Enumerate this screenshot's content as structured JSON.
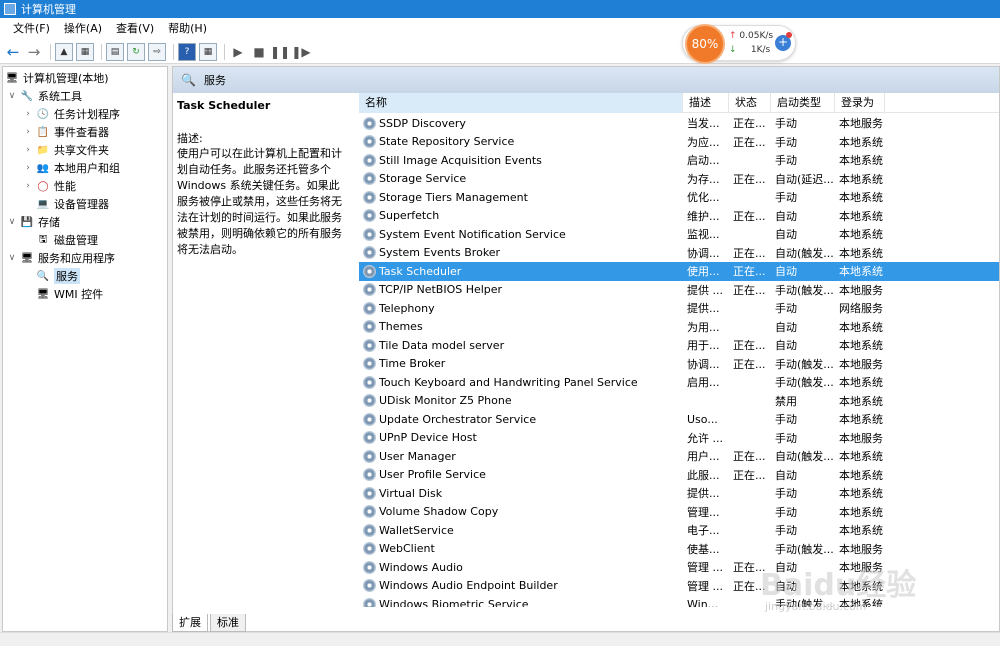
{
  "window": {
    "title": "计算机管理"
  },
  "menu": [
    "文件(F)",
    "操作(A)",
    "查看(V)",
    "帮助(H)"
  ],
  "widget": {
    "cpu": "80%",
    "up": "0.05K/s",
    "down": "1K/s"
  },
  "tree": {
    "root": "计算机管理(本地)",
    "system_tools": "系统工具",
    "task_scheduler": "任务计划程序",
    "event_viewer": "事件查看器",
    "shared_folders": "共享文件夹",
    "local_users": "本地用户和组",
    "performance": "性能",
    "device_manager": "设备管理器",
    "storage": "存储",
    "disk_management": "磁盘管理",
    "services_apps": "服务和应用程序",
    "services": "服务",
    "wmi": "WMI 控件"
  },
  "panel": {
    "title": "服务",
    "selected_name": "Task Scheduler",
    "desc_label": "描述:",
    "desc_text": "使用户可以在此计算机上配置和计划自动任务。此服务还托管多个 Windows 系统关键任务。如果此服务被停止或禁用，这些任务将无法在计划的时间运行。如果此服务被禁用，则明确依赖它的所有服务将无法启动。"
  },
  "columns": [
    "名称",
    "描述",
    "状态",
    "启动类型",
    "登录为"
  ],
  "rows": [
    [
      "SSDP Discovery",
      "当发...",
      "正在...",
      "手动",
      "本地服务"
    ],
    [
      "State Repository Service",
      "为应...",
      "正在...",
      "手动",
      "本地系统"
    ],
    [
      "Still Image Acquisition Events",
      "启动...",
      "",
      "手动",
      "本地系统"
    ],
    [
      "Storage Service",
      "为存...",
      "正在...",
      "自动(延迟...",
      "本地系统"
    ],
    [
      "Storage Tiers Management",
      "优化...",
      "",
      "手动",
      "本地系统"
    ],
    [
      "Superfetch",
      "维护...",
      "正在...",
      "自动",
      "本地系统"
    ],
    [
      "System Event Notification Service",
      "监视...",
      "",
      "自动",
      "本地系统"
    ],
    [
      "System Events Broker",
      "协调...",
      "正在...",
      "自动(触发...",
      "本地系统"
    ],
    [
      "Task Scheduler",
      "使用...",
      "正在...",
      "自动",
      "本地系统"
    ],
    [
      "TCP/IP NetBIOS Helper",
      "提供 ...",
      "正在...",
      "手动(触发...",
      "本地服务"
    ],
    [
      "Telephony",
      "提供...",
      "",
      "手动",
      "网络服务"
    ],
    [
      "Themes",
      "为用...",
      "",
      "自动",
      "本地系统"
    ],
    [
      "Tile Data model server",
      "用于...",
      "正在...",
      "自动",
      "本地系统"
    ],
    [
      "Time Broker",
      "协调...",
      "正在...",
      "手动(触发...",
      "本地服务"
    ],
    [
      "Touch Keyboard and Handwriting Panel Service",
      "启用...",
      "",
      "手动(触发...",
      "本地系统"
    ],
    [
      "UDisk Monitor Z5 Phone",
      "",
      "",
      "禁用",
      "本地系统"
    ],
    [
      "Update Orchestrator Service",
      "Uso...",
      "",
      "手动",
      "本地系统"
    ],
    [
      "UPnP Device Host",
      "允许 ...",
      "",
      "手动",
      "本地服务"
    ],
    [
      "User Manager",
      "用户...",
      "正在...",
      "自动(触发...",
      "本地系统"
    ],
    [
      "User Profile Service",
      "此服...",
      "正在...",
      "自动",
      "本地系统"
    ],
    [
      "Virtual Disk",
      "提供...",
      "",
      "手动",
      "本地系统"
    ],
    [
      "Volume Shadow Copy",
      "管理...",
      "",
      "手动",
      "本地系统"
    ],
    [
      "WalletService",
      "电子...",
      "",
      "手动",
      "本地系统"
    ],
    [
      "WebClient",
      "使基...",
      "",
      "手动(触发...",
      "本地服务"
    ],
    [
      "Windows Audio",
      "管理 ...",
      "正在...",
      "自动",
      "本地服务"
    ],
    [
      "Windows Audio Endpoint Builder",
      "管理 ...",
      "正在...",
      "自动",
      "本地系统"
    ],
    [
      "Windows Biometric Service",
      "Win...",
      "",
      "手动(触发...",
      "本地系统"
    ]
  ],
  "selected_row": 8,
  "tabs": [
    "扩展",
    "标准"
  ],
  "watermark": {
    "logo": "Baidu经验",
    "url": "jingyan.baidu.com"
  }
}
